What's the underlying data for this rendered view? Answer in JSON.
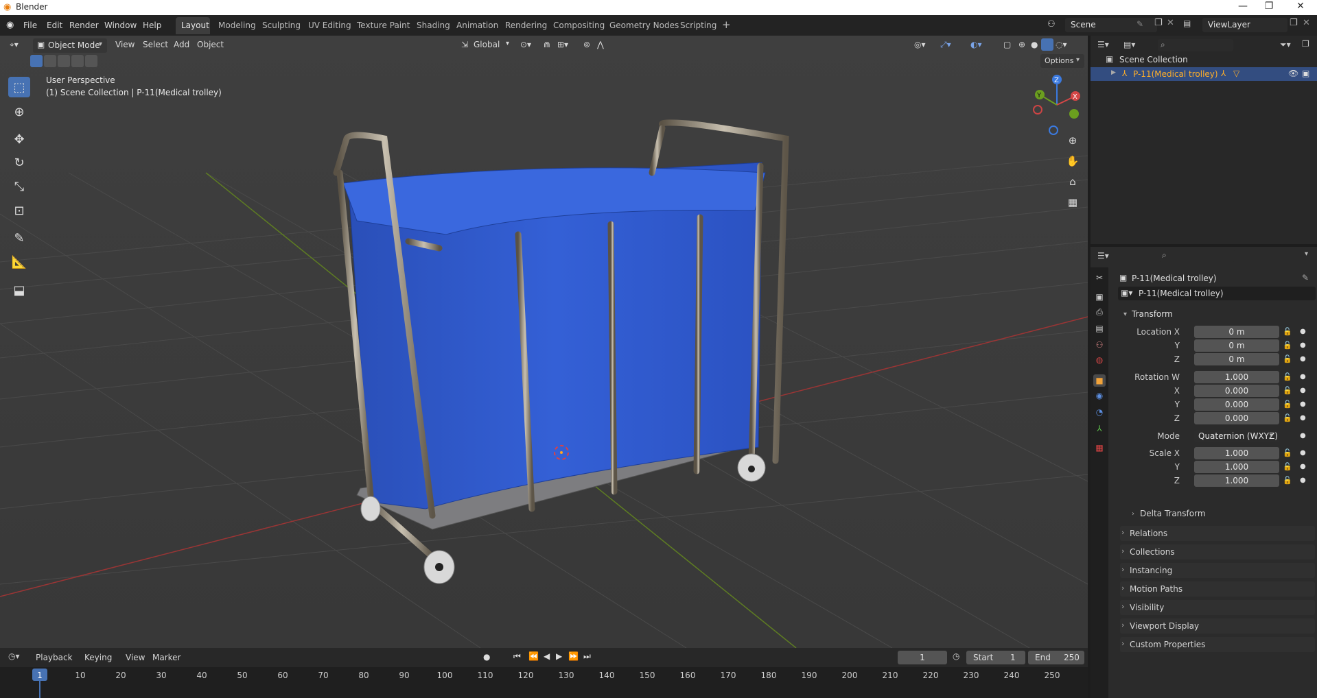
{
  "app": {
    "title": "Blender",
    "icon": "blender-logo-icon"
  },
  "window_controls": [
    "—",
    "❐",
    "✕"
  ],
  "menu": [
    "File",
    "Edit",
    "Render",
    "Window",
    "Help"
  ],
  "workspaces": [
    "Layout",
    "Modeling",
    "Sculpting",
    "UV Editing",
    "Texture Paint",
    "Shading",
    "Animation",
    "Rendering",
    "Compositing",
    "Geometry Nodes",
    "Scripting"
  ],
  "workspace_add": "+",
  "scene": {
    "name": "Scene",
    "view_layer": "ViewLayer"
  },
  "viewport": {
    "mode": "Object Mode",
    "menus": [
      "View",
      "Select",
      "Add",
      "Object"
    ],
    "orientation": "Global",
    "options": "Options",
    "info_line1": "User Perspective",
    "info_line2": "(1) Scene Collection | P-11(Medical trolley)",
    "gizmo_axes": {
      "z": "Z",
      "y": "Y",
      "x": "X"
    }
  },
  "outliner": {
    "root": "Scene Collection",
    "items": [
      {
        "label": "P-11(Medical trolley)",
        "selected": true
      }
    ]
  },
  "properties": {
    "object_name": "P-11(Medical trolley)",
    "data_name": "P-11(Medical trolley)",
    "transform_label": "Transform",
    "location": {
      "label": "Location X",
      "x": "0 m",
      "y": "0 m",
      "z": "0 m"
    },
    "rotation": {
      "label": "Rotation W",
      "w": "1.000",
      "x": "0.000",
      "y": "0.000",
      "z": "0.000"
    },
    "mode": {
      "label": "Mode",
      "value": "Quaternion (WXYZ)"
    },
    "scale": {
      "label": "Scale X",
      "x": "1.000",
      "y": "1.000",
      "z": "1.000"
    },
    "axis_labels": {
      "y": "Y",
      "z": "Z",
      "x": "X"
    },
    "delta": "Delta Transform",
    "panels": [
      "Relations",
      "Collections",
      "Instancing",
      "Motion Paths",
      "Visibility",
      "Viewport Display",
      "Custom Properties"
    ]
  },
  "timeline": {
    "menus": [
      "Playback",
      "Keying",
      "View",
      "Marker"
    ],
    "current_frame": "1",
    "start_label": "Start",
    "start": "1",
    "end_label": "End",
    "end": "250",
    "ruler": [
      "1",
      "10",
      "20",
      "30",
      "40",
      "50",
      "60",
      "70",
      "80",
      "90",
      "100",
      "110",
      "120",
      "130",
      "140",
      "150",
      "160",
      "170",
      "180",
      "190",
      "200",
      "210",
      "220",
      "230",
      "240",
      "250"
    ]
  },
  "colors": {
    "accent": "#4772b3",
    "selected_text": "#ffaf29",
    "trolley_cloth": "#2f5ad0",
    "x_axis": "#b53a3a",
    "y_axis": "#6b8f23"
  }
}
